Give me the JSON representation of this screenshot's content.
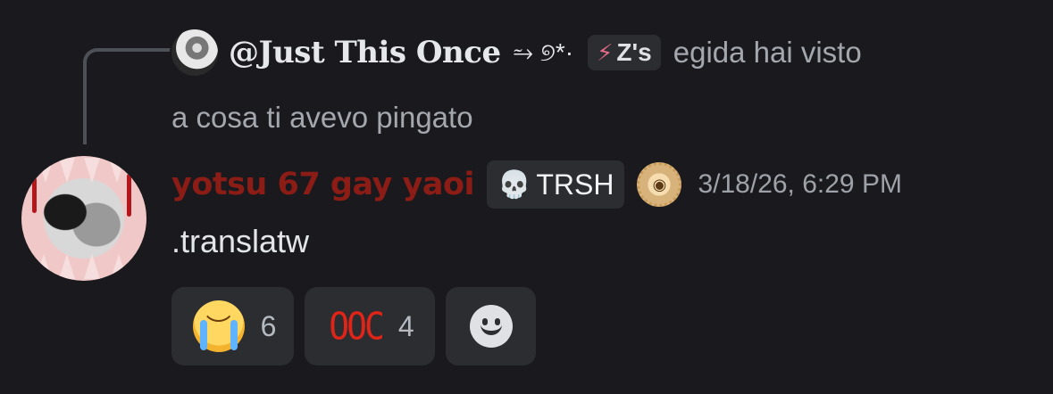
{
  "reply": {
    "author": "@Just This Once",
    "flourish": "⥲ ୭*·",
    "tag": {
      "icon": "⚡",
      "label": "Z's"
    },
    "preview_line1": "egida hai visto",
    "preview_line2": "a cosa ti avevo pingato"
  },
  "message": {
    "author": "yotsu 67 gay yaoi",
    "role": {
      "icon": "skull-icon",
      "label": "TRSH"
    },
    "badge": "coin-badge-icon",
    "timestamp": "3/18/26, 6:29 PM",
    "content": ".translatw",
    "author_color": "#8c1c16"
  },
  "reactions": [
    {
      "emoji": "loudly-crying-face",
      "glyph": "😭",
      "count": "6"
    },
    {
      "emoji": "ooc",
      "label": "OOC",
      "count": "4"
    },
    {
      "emoji": "add-reaction",
      "glyph": "☺"
    }
  ]
}
